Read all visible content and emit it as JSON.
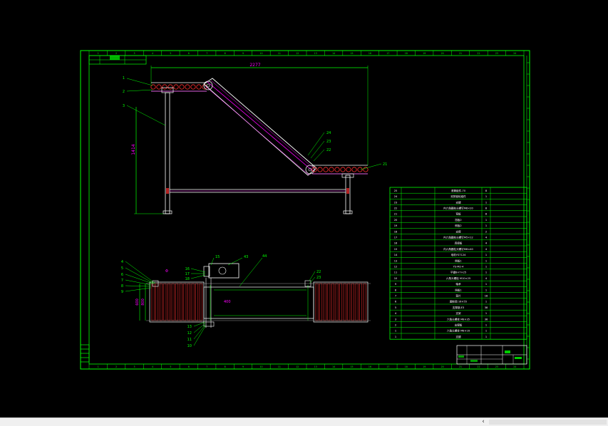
{
  "drawing": {
    "dimensions": {
      "overall_length": "2277",
      "height": "1414",
      "width_main": "600",
      "width_inner": "800",
      "motor_offset": "400"
    },
    "callouts_elevation": [
      "1",
      "2",
      "3",
      "24",
      "23",
      "22",
      "21"
    ],
    "callouts_plan_left": [
      "4",
      "5",
      "6",
      "7",
      "8",
      "9"
    ],
    "callouts_plan_motor": [
      "16",
      "17",
      "18",
      "15",
      "43",
      "44"
    ],
    "callouts_plan_bottom": [
      "13",
      "12",
      "11",
      "10",
      "10"
    ],
    "callouts_plan_right": [
      "22",
      "23"
    ]
  },
  "bom": {
    "rows": [
      {
        "no": "25",
        "name": "滚筒组件-70",
        "qty": "8"
      },
      {
        "no": "24",
        "name": "双排链轮组件",
        "qty": "1"
      },
      {
        "no": "23",
        "name": "支腿",
        "qty": "1"
      },
      {
        "no": "22",
        "name": "内六角圆柱头螺钉M8×20",
        "qty": "8"
      },
      {
        "no": "21",
        "name": "弯板",
        "qty": "8"
      },
      {
        "no": "20",
        "name": "挡板2",
        "qty": "1"
      },
      {
        "no": "19",
        "name": "侧板2",
        "qty": "1"
      },
      {
        "no": "18",
        "name": "支撑",
        "qty": "2"
      },
      {
        "no": "17",
        "name": "内六角圆柱头螺钉M5×12",
        "qty": "4"
      },
      {
        "no": "16",
        "name": "连接板",
        "qty": "4"
      },
      {
        "no": "15",
        "name": "内六角圆柱头螺钉M6×40",
        "qty": "4"
      },
      {
        "no": "14",
        "name": "电机YS7124",
        "qty": "1"
      },
      {
        "no": "13",
        "name": "侧板1",
        "qty": "1"
      },
      {
        "no": "12",
        "name": "YS-M2-4",
        "qty": "1"
      },
      {
        "no": "11",
        "name": "平键8×7×25",
        "qty": "1"
      },
      {
        "no": "10",
        "name": "六角头螺栓 M10×25",
        "qty": "4"
      },
      {
        "no": "9",
        "name": "轴承",
        "qty": "1"
      },
      {
        "no": "8",
        "name": "挡板1",
        "qty": "1"
      },
      {
        "no": "7",
        "name": "垫片",
        "qty": "18"
      },
      {
        "no": "6",
        "name": "圆柱销 16×55",
        "qty": "1"
      },
      {
        "no": "5",
        "name": "支撑钢-E3",
        "qty": "38"
      },
      {
        "no": "4",
        "name": "支架",
        "qty": "1"
      },
      {
        "no": "3",
        "name": "六角头螺栓 M8×35",
        "qty": "38"
      },
      {
        "no": "2",
        "name": "支撑板",
        "qty": "1"
      },
      {
        "no": "1",
        "name": "六角头螺栓 M8×16",
        "qty": "1"
      },
      {
        "no": "1",
        "name": "支腿",
        "qty": "1"
      }
    ]
  },
  "border": {
    "top_zones": [
      "1",
      "2",
      "3",
      "4",
      "5",
      "6",
      "7",
      "8",
      "9",
      "10",
      "11",
      "12",
      "13",
      "14",
      "15",
      "16",
      "17",
      "18",
      "19",
      "20",
      "21",
      "22",
      "23",
      "24"
    ],
    "bottom_zones": [
      "1",
      "2",
      "3",
      "4",
      "5",
      "6",
      "7",
      "8",
      "9",
      "10",
      "11",
      "12",
      "13",
      "14",
      "15",
      "16",
      "17",
      "18",
      "19",
      "20",
      "21",
      "22",
      "23",
      "24"
    ]
  },
  "colors": {
    "green": "#00ff00",
    "magenta": "#ff00ff",
    "white": "#ffffff",
    "red": "#ff3030",
    "gray": "#9a9a9a"
  },
  "statusbar": {
    "left_arrow": "‹"
  }
}
